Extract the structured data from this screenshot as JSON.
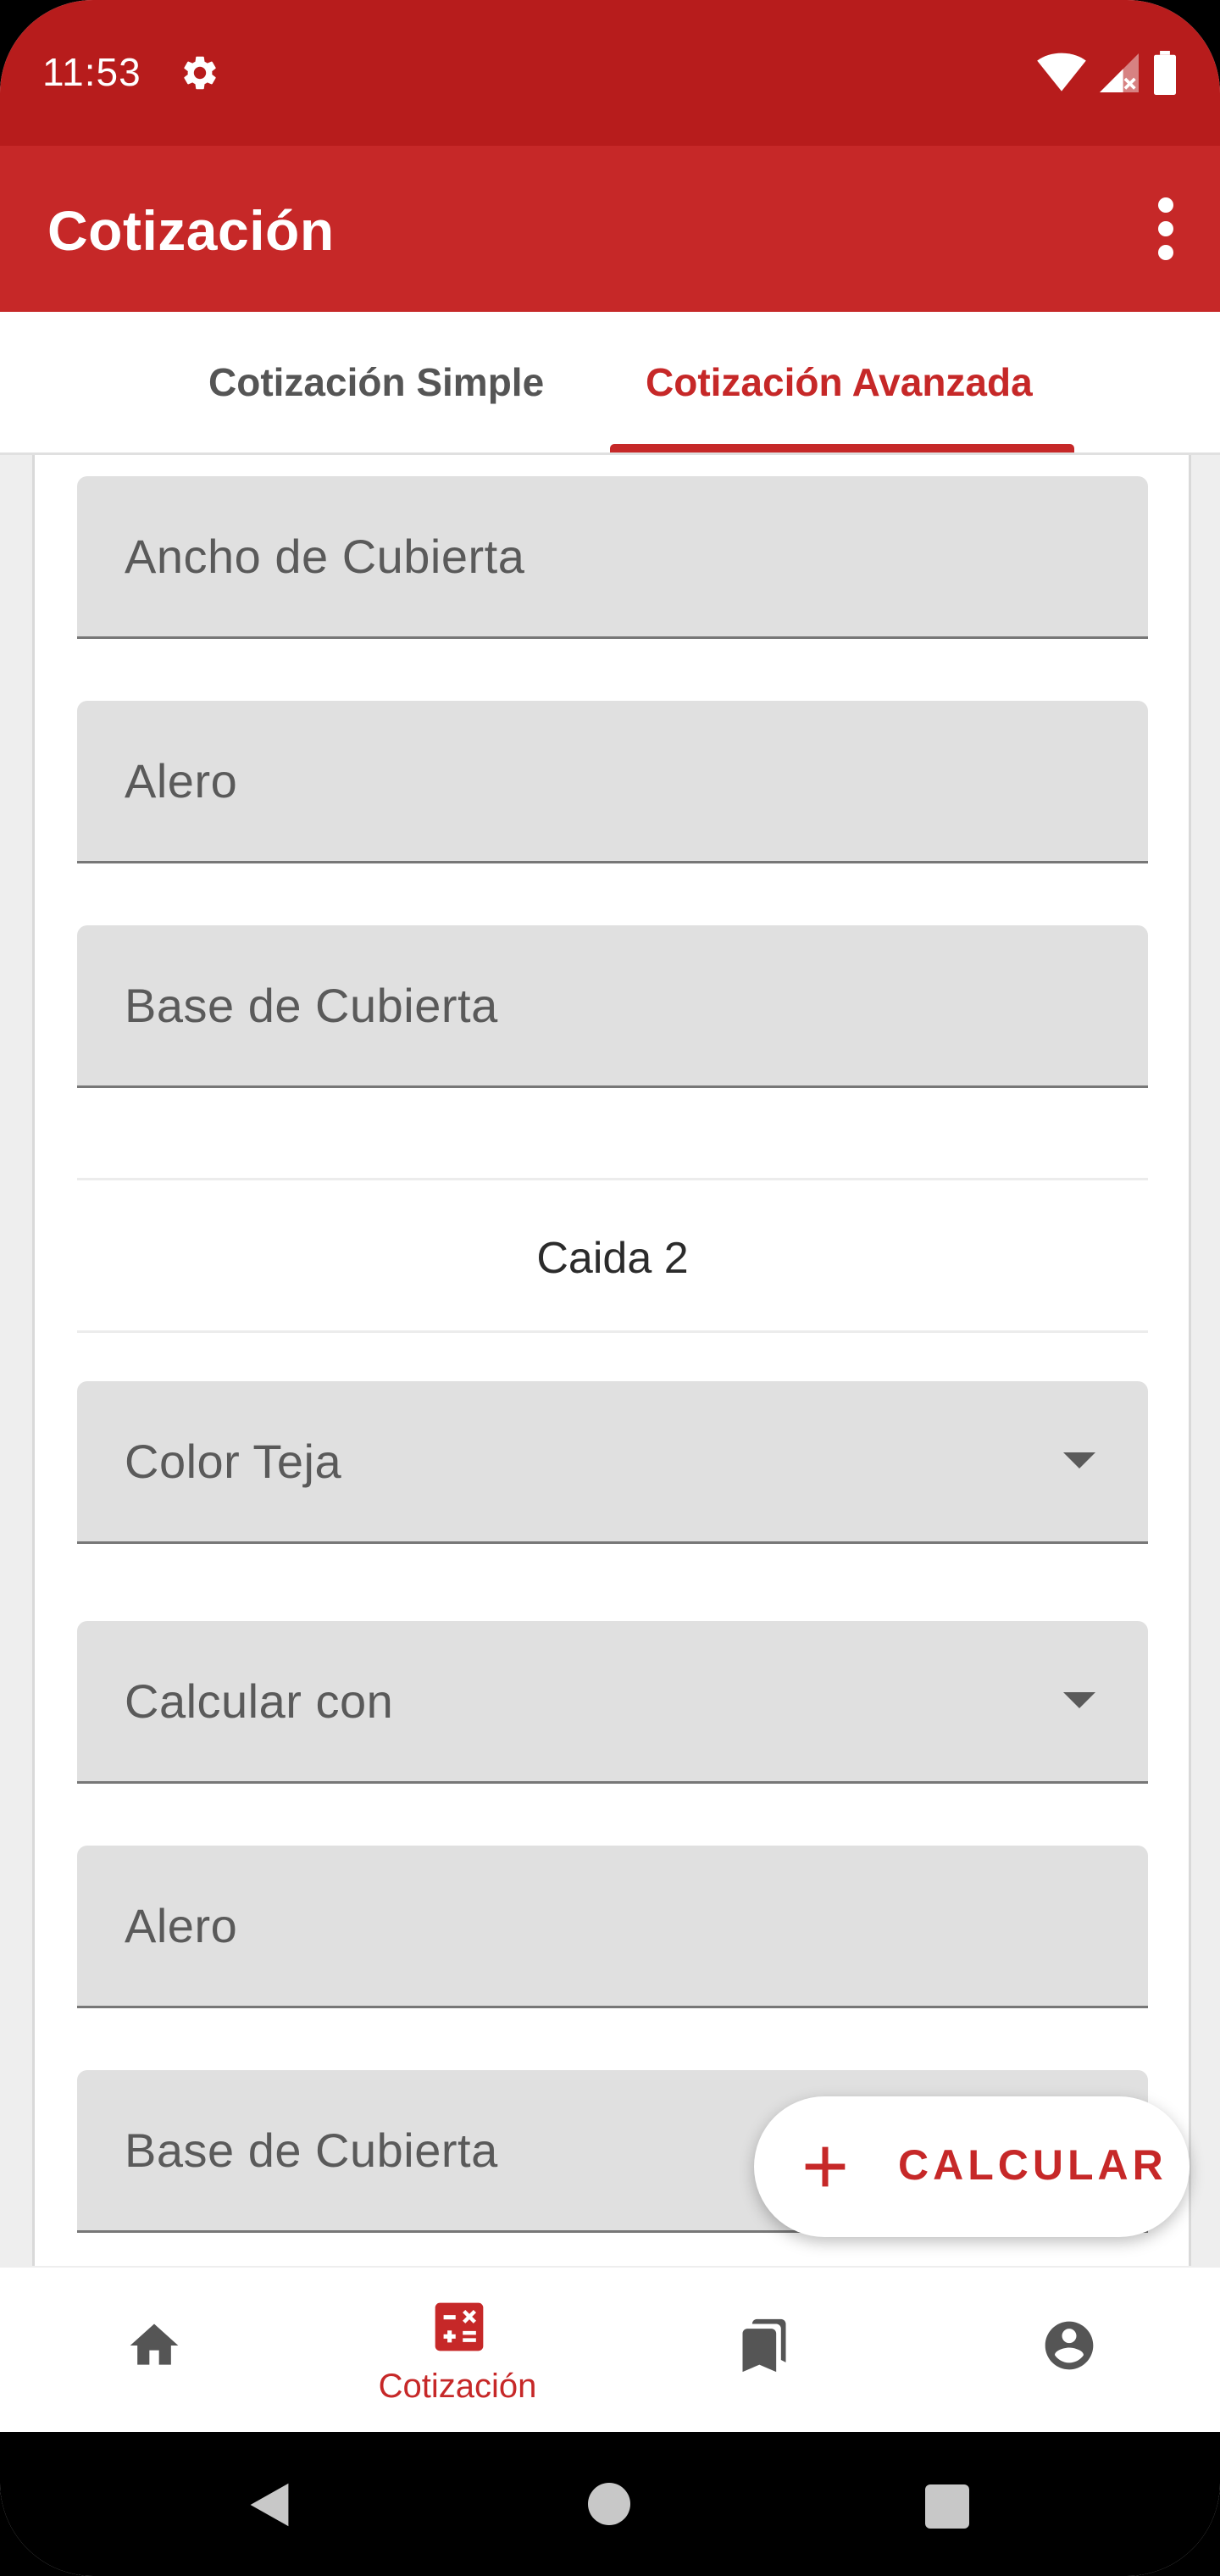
{
  "status_bar": {
    "time": "11:53",
    "icons": [
      "gear-icon",
      "wifi-icon",
      "signal-icon",
      "battery-icon"
    ]
  },
  "app_bar": {
    "title": "Cotización",
    "menu_icon": "more-vert-icon"
  },
  "tabs": [
    {
      "label": "Cotización Simple",
      "selected": false
    },
    {
      "label": "Cotización Avanzada",
      "selected": true
    }
  ],
  "form": {
    "fields_top": [
      {
        "label": "Ancho de Cubierta",
        "type": "text"
      },
      {
        "label": "Alero",
        "type": "text"
      },
      {
        "label": "Base de Cubierta",
        "type": "text"
      }
    ],
    "section_title": "Caida 2",
    "fields_section": [
      {
        "label": "Color Teja",
        "type": "dropdown"
      },
      {
        "label": "Calcular con",
        "type": "dropdown"
      },
      {
        "label": "Alero",
        "type": "text"
      },
      {
        "label": "Base de Cubierta",
        "type": "text"
      }
    ]
  },
  "fab": {
    "label": "CALCULAR",
    "icon": "plus-icon"
  },
  "bottom_nav": [
    {
      "icon": "home-icon",
      "label": "",
      "active": false
    },
    {
      "icon": "calculator-icon",
      "label": "Cotización",
      "active": true
    },
    {
      "icon": "bookmarks-icon",
      "label": "",
      "active": false
    },
    {
      "icon": "account-icon",
      "label": "",
      "active": false
    }
  ],
  "colors": {
    "primary": "#c62828",
    "primary_dark": "#b71c1c",
    "field_bg": "#e0e0e0"
  }
}
